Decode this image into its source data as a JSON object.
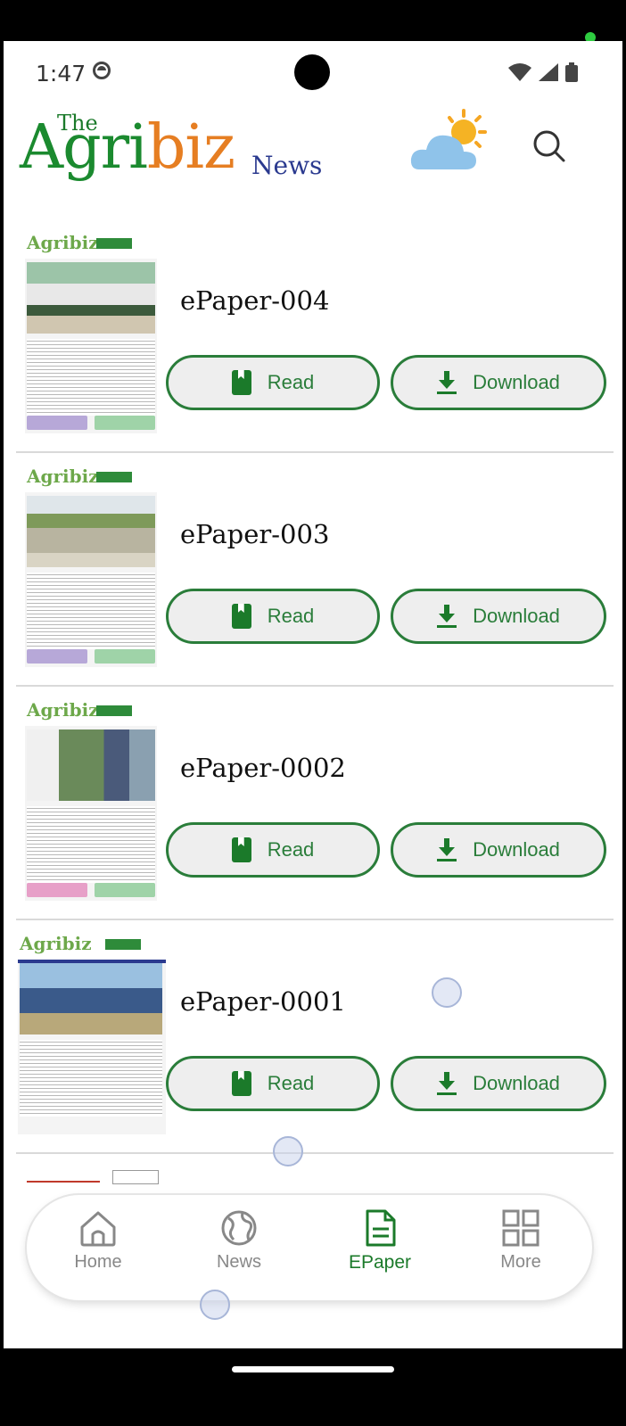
{
  "status_bar": {
    "time": "1:47"
  },
  "header": {
    "logo_the": "The",
    "logo_agri": "Agri",
    "logo_biz": "biz",
    "logo_news": "News"
  },
  "epapers": [
    {
      "title": "ePaper-004",
      "read_label": "Read",
      "download_label": "Download"
    },
    {
      "title": "ePaper-003",
      "read_label": "Read",
      "download_label": "Download"
    },
    {
      "title": "ePaper-0002",
      "read_label": "Read",
      "download_label": "Download"
    },
    {
      "title": "ePaper-0001",
      "read_label": "Read",
      "download_label": "Download"
    }
  ],
  "thumb_brand": "Agribiz",
  "bottom_nav": [
    {
      "label": "Home",
      "icon": "home-icon"
    },
    {
      "label": "News",
      "icon": "globe-icon"
    },
    {
      "label": "EPaper",
      "icon": "document-icon",
      "active": true
    },
    {
      "label": "More",
      "icon": "grid-icon"
    }
  ],
  "colors": {
    "accent_green": "#1b7a2a",
    "logo_orange": "#e67e22",
    "logo_blue": "#2b3a8f"
  }
}
